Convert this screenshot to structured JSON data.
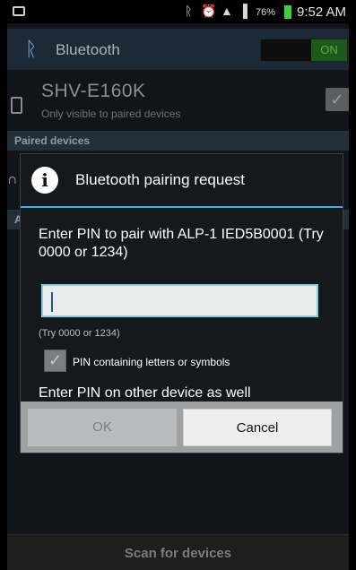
{
  "status_bar": {
    "icons": [
      "image-icon",
      "bluetooth-icon",
      "alarm-icon",
      "wifi-icon",
      "signal-icon"
    ],
    "battery_percent": "76%",
    "battery_color": "#3ad33a",
    "time": "9:52 AM"
  },
  "action_bar": {
    "title": "Bluetooth",
    "toggle_label": "ON"
  },
  "device": {
    "name": "SHV-E160K",
    "visibility": "Only visible to paired devices"
  },
  "sections": {
    "paired": "Paired devices",
    "available_partial": "Av"
  },
  "dialog": {
    "title": "Bluetooth pairing request",
    "prompt": "Enter PIN to pair with ALP-1 IED5B0001 (Try 0000 or 1234)",
    "pin_value": "",
    "hint": "(Try 0000 or 1234)",
    "checkbox_label": "PIN containing letters or symbols",
    "checkbox_checked": true,
    "also_text": "Enter PIN on other device as well",
    "ok_label": "OK",
    "cancel_label": "Cancel",
    "accent_color": "#3bb2e8"
  },
  "bottom": {
    "scan_label": "Scan for devices"
  }
}
